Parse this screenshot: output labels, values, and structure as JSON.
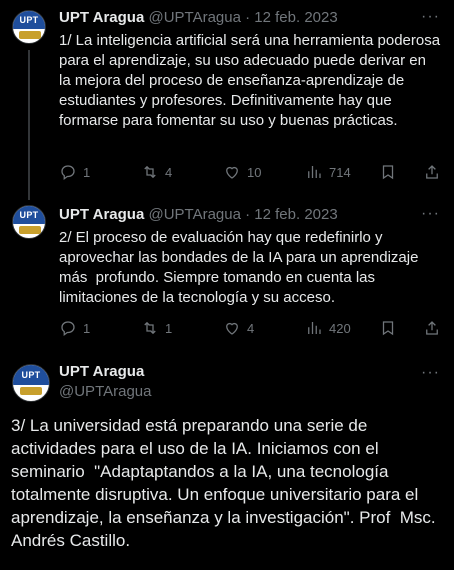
{
  "tweets": [
    {
      "name": "UPT Aragua",
      "handle": "@UPTAragua · 12 feb. 2023",
      "text": "1/ La inteligencia artificial será una herramienta poderosa para el aprendizaje, su uso adecuado puede derivar en la mejora del proceso de enseñanza-aprendizaje de estudiantes y profesores. Definitivamente hay que formarse para fomentar su uso y buenas prácticas.",
      "replies": "1",
      "retweets": "4",
      "likes": "10",
      "views": "714"
    },
    {
      "name": "UPT Aragua",
      "handle": "@UPTAragua · 12 feb. 2023",
      "text": "2/ El proceso de evaluación hay que redefinirlo y aprovechar las bondades de la IA para un aprendizaje más  profundo. Siempre tomando en cuenta las limitaciones de la tecnología y su acceso.",
      "replies": "1",
      "retweets": "1",
      "likes": "4",
      "views": "420"
    }
  ],
  "main_tweet": {
    "name": "UPT Aragua",
    "handle": "@UPTAragua",
    "text": "3/ La universidad está preparando una serie de actividades para el uso de la IA. Iniciamos con el seminario  \"Adaptaptandos a la IA, una tecnología totalmente disruptiva. Un enfoque universitario para el aprendizaje, la enseñanza y la investigación\". Prof  Msc. Andrés Castillo."
  },
  "avatar_label": "UPT",
  "more_glyph": "···",
  "colors": {
    "background": "#000000",
    "text": "#e7e9ea",
    "muted": "#71767b",
    "thread_line": "#333639"
  }
}
